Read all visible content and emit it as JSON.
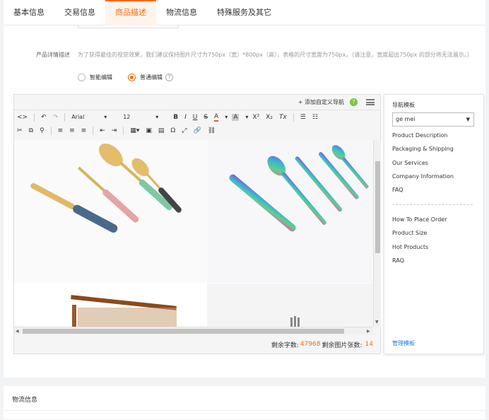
{
  "tabs": [
    "基本信息",
    "交易信息",
    "商品描述",
    "物流信息",
    "特殊服务及其它"
  ],
  "active_tab": 2,
  "detail": {
    "label": "产品详情描述",
    "hint": "为了获得最佳的视觉效果，我们建议保持图片尺寸为750px（宽）*800px（高），表格的尺寸宽度为750px。（请注意，宽度超出750px 的部分将无法展示。）",
    "mode_smart": "智能编辑",
    "mode_normal": "普通编辑",
    "help": "?"
  },
  "editor": {
    "add_nav": "+ 添加自定义导航",
    "help": "?",
    "font_family": "Arial",
    "font_size": "12",
    "remaining_chars_label": "剩余字数:",
    "remaining_chars": "47968",
    "remaining_images_label": "剩余图片张数:",
    "remaining_images": "14"
  },
  "nav_template": {
    "title": "导航模板",
    "selected": "ge mei",
    "items_top": [
      "Product Description",
      "Packaging & Shipping",
      "Our Services",
      "Company Information",
      "FAQ"
    ],
    "items_bottom": [
      "How To Place Order",
      "Product Size",
      "Hot Products",
      "RAQ"
    ],
    "manage": "管理模板"
  },
  "logistics": {
    "title": "物流信息"
  },
  "colors": {
    "accent": "#ff6a00",
    "link": "#1e7bd4"
  }
}
